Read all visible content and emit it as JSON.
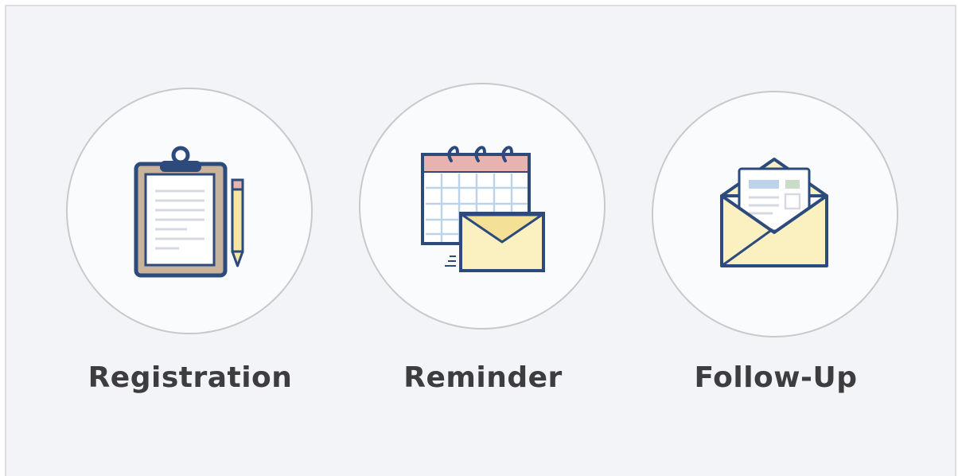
{
  "steps": [
    {
      "label": "Registration",
      "icon": "clipboard-icon"
    },
    {
      "label": "Reminder",
      "icon": "calendar-envelope-icon"
    },
    {
      "label": "Follow-Up",
      "icon": "open-envelope-icon"
    }
  ],
  "colors": {
    "background": "#f3f4f7",
    "circle_fill": "#fafbfd",
    "circle_border": "#c9c9cc",
    "icon_outline": "#2c4a7c",
    "icon_yellow": "#fbf0c0",
    "icon_pink": "#e8b2ae",
    "icon_tan": "#c9b39b",
    "label_text": "#3d3d3f"
  }
}
